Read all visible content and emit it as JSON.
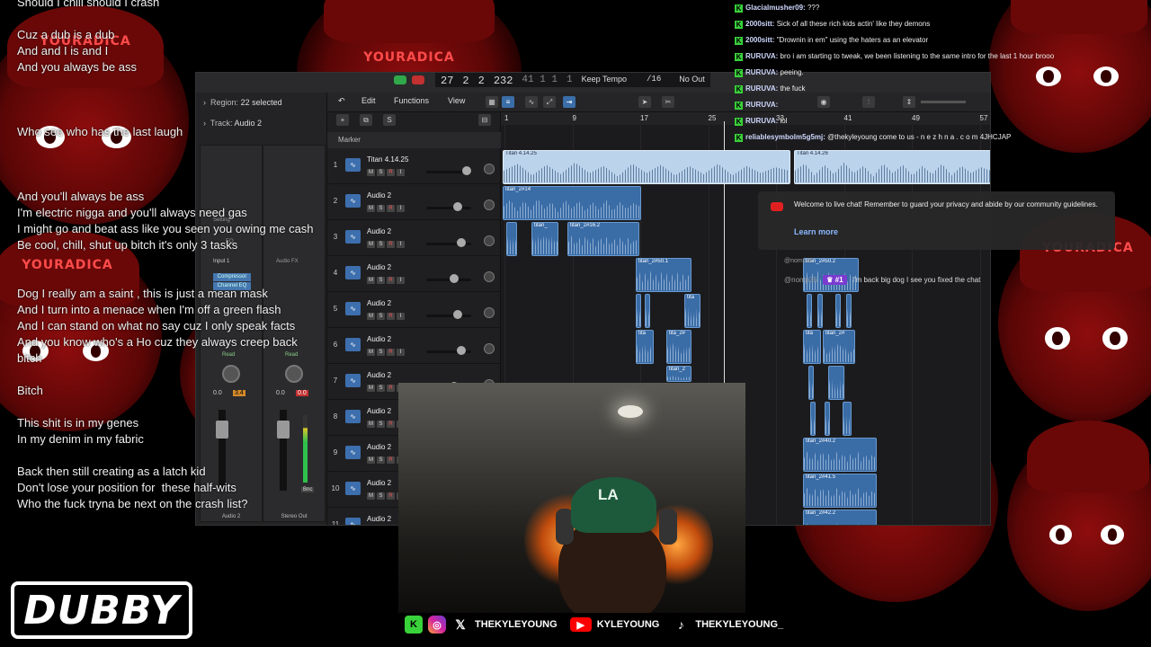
{
  "background": {
    "brand_text": "YOURADICA",
    "accent": "#8e0d0d"
  },
  "lyrics": [
    "Should I chill should I crash",
    "",
    "Cuz a dub is a dub",
    "And and I is and I",
    "And you always be ass",
    "",
    "",
    "",
    "Who see who has the last laugh",
    "",
    "",
    "",
    "And you'll always be ass",
    "I'm electric nigga and you'll always need gas",
    "I might go and beat ass like you seen you owing me cash",
    "Be cool, chill, shut up bitch it's only 3 tasks",
    "",
    "",
    "Dog I really am a saint , this is just a mean mask",
    "And I turn into a menace when I'm off a green flash",
    "And I can stand on what no say cuz I only speak facts",
    "And you know who's a Ho cuz they always creep back",
    "bitch",
    "",
    "Bitch",
    "",
    "This shit is in my genes",
    "In my denim in my fabric",
    "",
    "Back then still creating as a latch kid",
    "Don't lose your position for  these half-wits",
    "Who the fuck tryna be next on the crash list?"
  ],
  "daw": {
    "lcd": {
      "bars": "27",
      "beat": "2",
      "div": "2",
      "ticks": "232",
      "pos2": "41  1  1",
      "pos3": "1",
      "tempo_mode": "Keep Tempo",
      "signature": "/16",
      "output": "No Out"
    },
    "inspector": {
      "region_label": "Region:",
      "region_value": "22 selected",
      "track_label": "Track:",
      "track_value": "Audio 2",
      "setting": "Setting",
      "eq": "EQ",
      "input": "Input 1",
      "audio_fx": "Audio FX",
      "plugin1": "Compressor",
      "plugin2": "Channel EQ",
      "read1": "Read",
      "read2": "Read",
      "val1": "0.0",
      "val2": "3.4",
      "val3": "0.0",
      "val4": "0.0",
      "bnc": "Bnc",
      "strip1": "Audio 2",
      "strip2": "Stereo Out"
    },
    "toolbar": {
      "edit": "Edit",
      "functions": "Functions",
      "view": "View"
    },
    "marker_label": "Marker",
    "ruler": [
      "1",
      "9",
      "17",
      "25",
      "33",
      "41",
      "49",
      "57"
    ],
    "tracks": [
      {
        "num": "1",
        "name": "Titan 4.14.25"
      },
      {
        "num": "2",
        "name": "Audio 2"
      },
      {
        "num": "3",
        "name": "Audio 2"
      },
      {
        "num": "4",
        "name": "Audio 2"
      },
      {
        "num": "5",
        "name": "Audio 2"
      },
      {
        "num": "6",
        "name": "Audio 2"
      },
      {
        "num": "7",
        "name": "Audio 2"
      },
      {
        "num": "8",
        "name": "Audio 2"
      },
      {
        "num": "9",
        "name": "Audio 2"
      },
      {
        "num": "10",
        "name": "Audio 2"
      },
      {
        "num": "11",
        "name": "Audio 2"
      }
    ],
    "regions": {
      "r1": "Titan 4.14.25",
      "r2": "Titan 4.14.26",
      "r3": "titan_2#14",
      "r4": "titan_",
      "r5": "titan_2#16.2",
      "r6": "titan_2#50.1",
      "r7": "tita",
      "r8": "tita",
      "r9": "tita_2#",
      "r10": "titan_2",
      "r11": "titan_2#50.2",
      "r12": "tita",
      "r13": "titan_2#",
      "r14": "titan_2#40.2",
      "r15": "titan_2#41.5",
      "r16": "titan_2#42.2"
    }
  },
  "chat": [
    {
      "user": "Glacialmusher09:",
      "msg": "???"
    },
    {
      "user": "2000sitt:",
      "msg": "Sick of all these rich kids actin' like they demons"
    },
    {
      "user": "2000sitt:",
      "msg": "\"Drownin in em\" using the haters as an elevator"
    },
    {
      "user": "RURUVA:",
      "msg": "bro i am starting to tweak, we been listening to the same intro for the last 1 hour brooo"
    },
    {
      "user": "RURUVA:",
      "msg": "peeing."
    },
    {
      "user": "RURUVA:",
      "msg": "the fuck"
    },
    {
      "user": "RURUVA:",
      "msg": ""
    },
    {
      "user": "RURUVA:",
      "msg": "lol"
    },
    {
      "user": "reliablesymbolm5g5mj:",
      "msg": "@thekyleyoung come to us - n e z h n a . c o m 4JHCJAP"
    }
  ],
  "notice": {
    "text": "Welcome to live chat! Remember to guard your privacy and abide by our community guidelines.",
    "link": "Learn more"
  },
  "superchat": {
    "user": "@nomp35",
    "badge": "#1",
    "msg": "I'm back big dog I see you fixed the chat",
    "ghost_user": "@nomp35"
  },
  "webcam": {
    "cap_logo": "LA"
  },
  "social": {
    "x_handle": "THEKYLEYOUNG",
    "yt_handle": "KYLEYOUNG",
    "tt_handle": "THEKYLEYOUNG_"
  },
  "logo_text": "DUBBY"
}
